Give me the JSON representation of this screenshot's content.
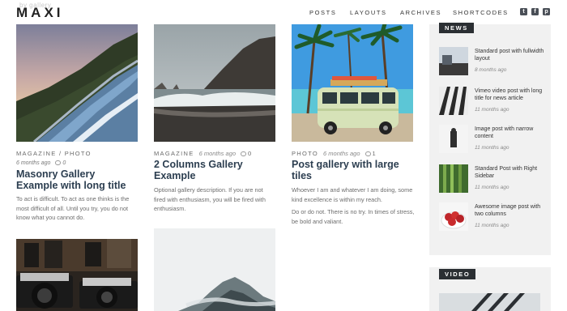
{
  "header": {
    "logo": "MAXI",
    "logo_ghost": "by gallery",
    "nav": [
      "POSTS",
      "LAYOUTS",
      "ARCHIVES",
      "SHORTCODES"
    ],
    "social_icons": [
      "twitter-icon",
      "facebook-icon",
      "pinterest-icon"
    ]
  },
  "posts": [
    {
      "category": "MAGAZINE / PHOTO",
      "date": "6 months ago",
      "comments": "0",
      "title": "Masonry Gallery Example with long title",
      "excerpt": "To act is difficult. To act as one thinks is the most difficult of all. Until you try, you do not know what you cannot do."
    },
    {
      "category": "MAGAZINE",
      "date": "6 months ago",
      "comments": "0",
      "title": "2 Columns Gallery Example",
      "excerpt": "Optional gallery description. If you are not fired with enthusiasm, you will be fired with enthusiasm."
    },
    {
      "category": "PHOTO",
      "date": "6 months ago",
      "comments": "1",
      "title": "Post gallery with large tiles",
      "excerpt": "Whoever I am and whatever I am doing, some kind excellence is within my reach.",
      "excerpt2": "Do or do not. There is no try. In times of stress, be bold and valiant."
    }
  ],
  "sidebar": {
    "news_label": "NEWS",
    "news": [
      {
        "title": "Standard post with fullwidth layout",
        "date": "8 months ago"
      },
      {
        "title": "Vimeo video post with long title for news article",
        "date": "11 months ago"
      },
      {
        "title": "Image post with narrow content",
        "date": "11 months ago"
      },
      {
        "title": "Standard Post with Right Sidebar",
        "date": "11 months ago"
      },
      {
        "title": "Awesome image post with two columns",
        "date": "11 months ago"
      }
    ],
    "video_label": "VIDEO"
  }
}
